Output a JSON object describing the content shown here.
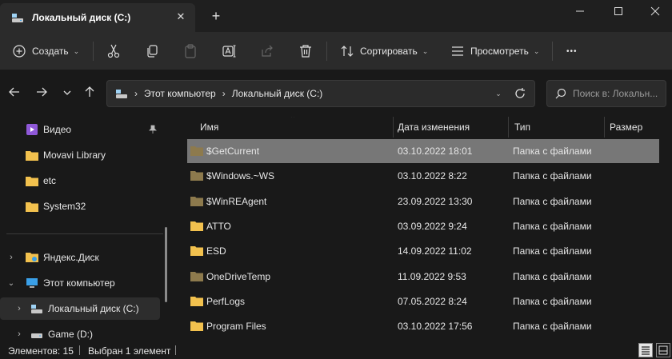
{
  "window": {
    "tab_title": "Локальный диск (C:)",
    "tab_close": "✕",
    "new_tab": "+"
  },
  "toolbar": {
    "create_label": "Создать",
    "sort_label": "Сортировать",
    "view_label": "Просмотреть",
    "more_label": "•••"
  },
  "address": {
    "crumbs": [
      "Этот компьютер",
      "Локальный диск (C:)"
    ],
    "search_placeholder": "Поиск в: Локальн..."
  },
  "sidebar": {
    "pinned": [
      {
        "label": "Видео",
        "icon": "video-folder-icon"
      },
      {
        "label": "Movavi Library",
        "icon": "folder-icon"
      },
      {
        "label": "etc",
        "icon": "folder-icon"
      },
      {
        "label": "System32",
        "icon": "folder-icon"
      }
    ],
    "tree": [
      {
        "label": "Яндекс.Диск",
        "icon": "yandex-disk-icon"
      },
      {
        "label": "Этот компьютер",
        "icon": "computer-icon"
      },
      {
        "label": "Локальный диск (C:)",
        "icon": "drive-icon"
      },
      {
        "label": "Game (D:)",
        "icon": "drive-icon"
      }
    ]
  },
  "columns": {
    "name": "Имя",
    "date": "Дата изменения",
    "type": "Тип",
    "size": "Размер"
  },
  "files": [
    {
      "name": "$GetCurrent",
      "date": "03.10.2022 18:01",
      "type": "Папка с файлами",
      "hidden": true
    },
    {
      "name": "$Windows.~WS",
      "date": "03.10.2022 8:22",
      "type": "Папка с файлами",
      "hidden": true
    },
    {
      "name": "$WinREAgent",
      "date": "23.09.2022 13:30",
      "type": "Папка с файлами",
      "hidden": true
    },
    {
      "name": "ATTO",
      "date": "03.09.2022 9:24",
      "type": "Папка с файлами",
      "hidden": false
    },
    {
      "name": "ESD",
      "date": "14.09.2022 11:02",
      "type": "Папка с файлами",
      "hidden": false
    },
    {
      "name": "OneDriveTemp",
      "date": "11.09.2022 9:53",
      "type": "Папка с файлами",
      "hidden": true
    },
    {
      "name": "PerfLogs",
      "date": "07.05.2022 8:24",
      "type": "Папка с файлами",
      "hidden": false
    },
    {
      "name": "Program Files",
      "date": "03.10.2022 17:56",
      "type": "Папка с файлами",
      "hidden": false
    }
  ],
  "status": {
    "count": "Элементов: 15",
    "selected": "Выбран 1 элемент"
  },
  "colors": {
    "folder": "#f2c14e",
    "folder_hidden": "#8d7a4d",
    "selection": "#777777",
    "video_icon": "#8f58d8",
    "computer_icon": "#3aa0e8"
  }
}
